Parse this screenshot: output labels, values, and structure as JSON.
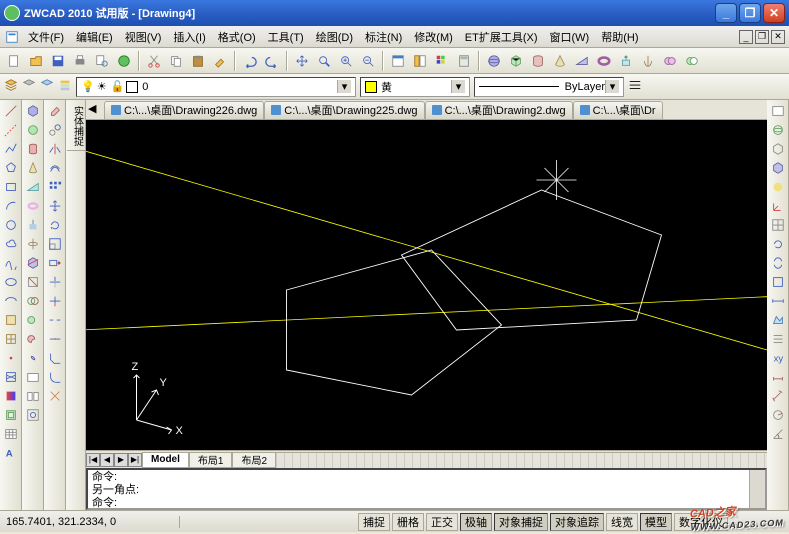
{
  "title": "ZWCAD 2010 试用版 - [Drawing4]",
  "menu": {
    "items": [
      "文件(F)",
      "编辑(E)",
      "视图(V)",
      "插入(I)",
      "格式(O)",
      "工具(T)",
      "绘图(D)",
      "标注(N)",
      "修改(M)",
      "ET扩展工具(X)",
      "窗口(W)",
      "帮助(H)"
    ]
  },
  "layer_combo": {
    "value": "0"
  },
  "color_combo": {
    "value": "黄",
    "swatch": "#ffff00"
  },
  "linetype_combo": {
    "value": "ByLayer"
  },
  "file_tabs": [
    "C:\\...\\桌面\\Drawing226.dwg",
    "C:\\...\\桌面\\Drawing225.dwg",
    "C:\\...\\桌面\\Drawing2.dwg",
    "C:\\...\\桌面\\Dr"
  ],
  "model_tabs": {
    "nav": [
      "|◀",
      "◀",
      "▶",
      "▶|"
    ],
    "tabs": [
      "Model",
      "布局1",
      "布局2"
    ],
    "active": 0
  },
  "sidebar_title": "实体捕捉",
  "command": {
    "lines": [
      "命令:",
      "另一角点:",
      "命令:"
    ]
  },
  "status": {
    "coords": "165.7401, 321.2334, 0",
    "toggles": [
      "捕捉",
      "栅格",
      "正交",
      "极轴",
      "对象捕捉",
      "对象追踪",
      "线宽",
      "模型",
      "数字化仪"
    ],
    "active": [
      3,
      4,
      5,
      7
    ]
  },
  "ucs_labels": {
    "x": "X",
    "y": "Y",
    "z": "Z"
  },
  "watermark": {
    "main": "CAD之家",
    "sub": "WWW.CAD23.COM"
  },
  "icons": {
    "new": "□",
    "open": "📂",
    "save": "💾",
    "print": "🖨",
    "cut": "✂",
    "copy": "⧉",
    "paste": "📋",
    "undo": "↶",
    "redo": "↷",
    "pan": "✋",
    "zoom": "🔍",
    "dim": "↔",
    "block": "▦",
    "sphere": "●",
    "box": "▣",
    "cyl": "◍",
    "cone": "▲",
    "torus": "◎"
  }
}
